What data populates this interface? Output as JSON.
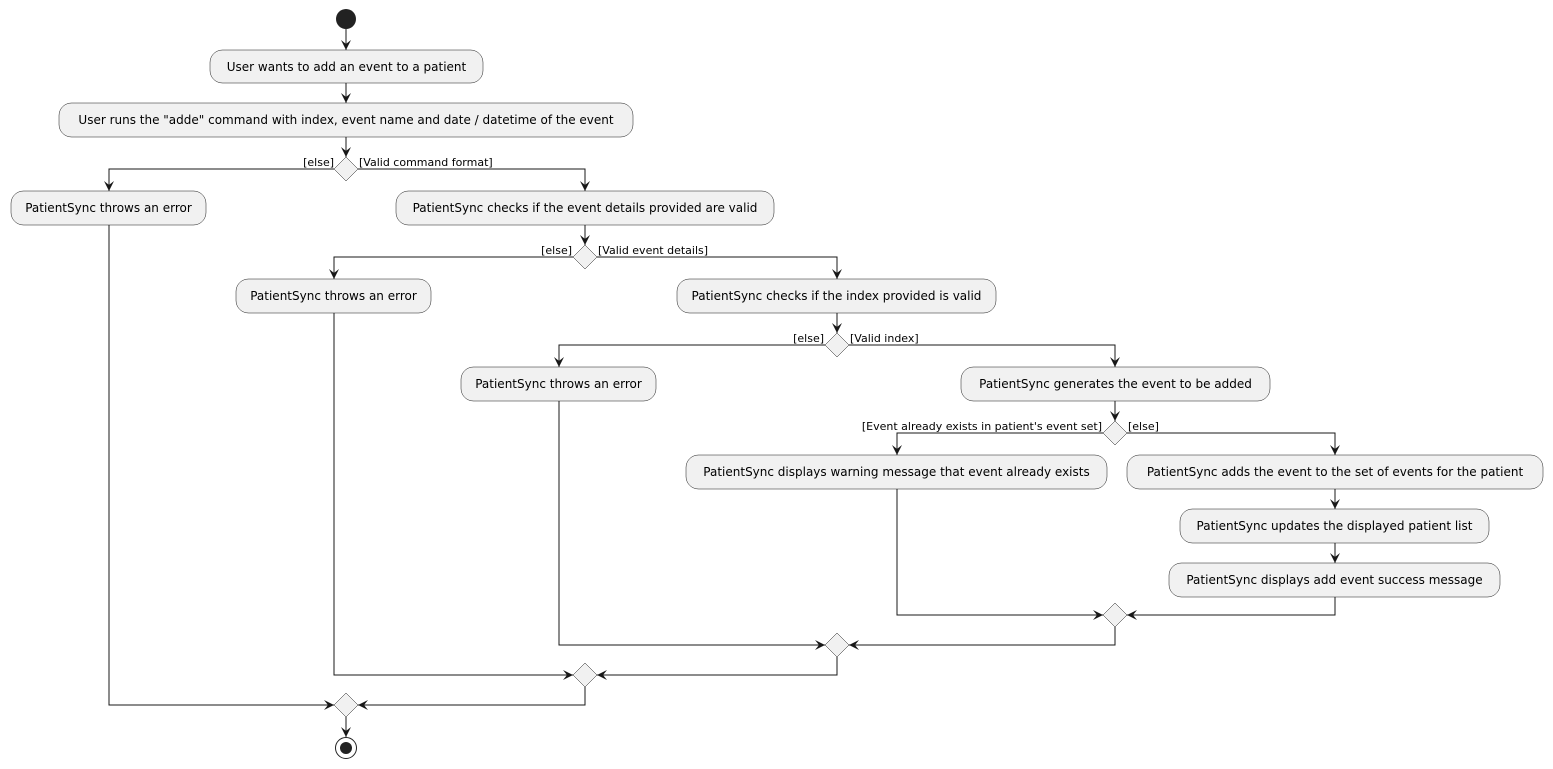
{
  "diagram": {
    "type": "activity",
    "start": {
      "label": "start"
    },
    "end": {
      "label": "stop"
    },
    "actions": [
      {
        "id": "a1",
        "label": "User wants to add an event to a patient"
      },
      {
        "id": "a2",
        "label": "User runs the \"adde\" command with index, event name and date / datetime of the event"
      },
      {
        "id": "a3",
        "label": "PatientSync throws an error"
      },
      {
        "id": "a4",
        "label": "PatientSync checks if the event details provided are valid"
      },
      {
        "id": "a5",
        "label": "PatientSync throws an error"
      },
      {
        "id": "a6",
        "label": "PatientSync checks if the index provided is valid"
      },
      {
        "id": "a7",
        "label": "PatientSync throws an error"
      },
      {
        "id": "a8",
        "label": "PatientSync generates the event to be added"
      },
      {
        "id": "a9",
        "label": "PatientSync displays warning message that event already exists"
      },
      {
        "id": "a10",
        "label": "PatientSync adds the event to the set of events for the patient"
      },
      {
        "id": "a11",
        "label": "PatientSync updates the displayed patient list"
      },
      {
        "id": "a12",
        "label": "PatientSync displays add event success message"
      }
    ],
    "decisions": [
      {
        "id": "d1",
        "left_guard": "[else]",
        "right_guard": "[Valid command format]"
      },
      {
        "id": "d2",
        "left_guard": "[else]",
        "right_guard": "[Valid event details]"
      },
      {
        "id": "d3",
        "left_guard": "[else]",
        "right_guard": "[Valid index]"
      },
      {
        "id": "d4",
        "left_guard": "[Event already exists in patient's event set]",
        "right_guard": "[else]"
      }
    ]
  }
}
